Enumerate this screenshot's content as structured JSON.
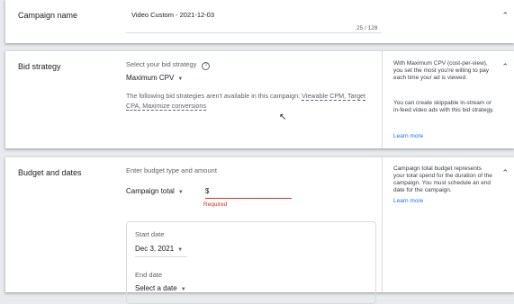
{
  "campaign_name": {
    "title": "Campaign name",
    "value": "Video Custom - 2021-12-03",
    "char_count": "25 / 128"
  },
  "bid_strategy": {
    "title": "Bid strategy",
    "prompt": "Select your bid strategy",
    "selected": "Maximum CPV",
    "unavailable_text": "The following bid strategies aren't available in this campaign:",
    "unavailable_1": "Viewable CPM,",
    "unavailable_2": "Target CPA,",
    "unavailable_3": "Maximize conversions",
    "help_1": "With Maximum CPV (cost-per-view), you set the most you're willing to pay each time your ad is viewed.",
    "help_2": "You can create skippable in-stream or in-feed video ads with this bid strategy.",
    "learn_more": "Learn more"
  },
  "budget_dates": {
    "title": "Budget and dates",
    "prompt": "Enter budget type and amount",
    "budget_type": "Campaign total",
    "currency": "$",
    "required": "Required",
    "start_label": "Start date",
    "start_value": "Dec 3, 2021",
    "end_label": "End date",
    "end_value": "Select a date",
    "help": "Campaign total budget represents your total spend for the duration of the campaign. You must schedule an end date for the campaign.",
    "learn_more": "Learn more"
  },
  "icons": {
    "help": "help-circle-icon",
    "expand": "chevron-up-icon",
    "dropdown": "caret-down-icon",
    "cursor": "mouse-cursor-icon"
  },
  "colors": {
    "link": "#1a73e8",
    "required": "#d93025",
    "background": "#e8eaed"
  }
}
